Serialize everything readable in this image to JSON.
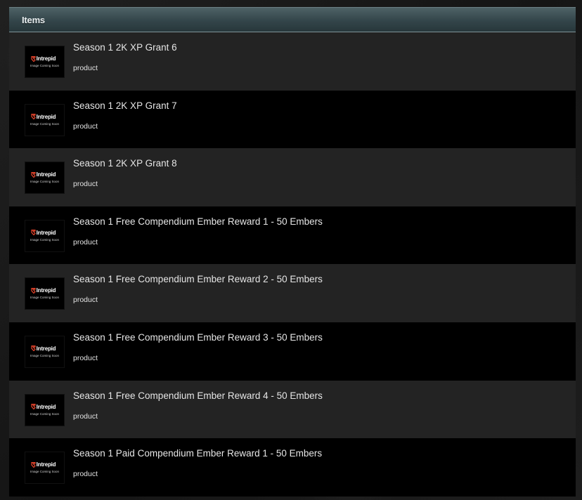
{
  "panel": {
    "title": "Items"
  },
  "thumbnail": {
    "logo_text": "Intrepid",
    "caption": "Image Coming Soon",
    "logo_color": "#e8452c"
  },
  "items": [
    {
      "name": "Season 1 2K XP Grant 6",
      "type": "product"
    },
    {
      "name": "Season 1 2K XP Grant 7",
      "type": "product"
    },
    {
      "name": "Season 1 2K XP Grant 8",
      "type": "product"
    },
    {
      "name": "Season 1 Free Compendium Ember Reward 1 - 50 Embers",
      "type": "product"
    },
    {
      "name": "Season 1 Free Compendium Ember Reward 2 - 50 Embers",
      "type": "product"
    },
    {
      "name": "Season 1 Free Compendium Ember Reward 3 - 50 Embers",
      "type": "product"
    },
    {
      "name": "Season 1 Free Compendium Ember Reward 4 - 50 Embers",
      "type": "product"
    },
    {
      "name": "Season 1 Paid Compendium Ember Reward 1 - 50 Embers",
      "type": "product"
    }
  ]
}
